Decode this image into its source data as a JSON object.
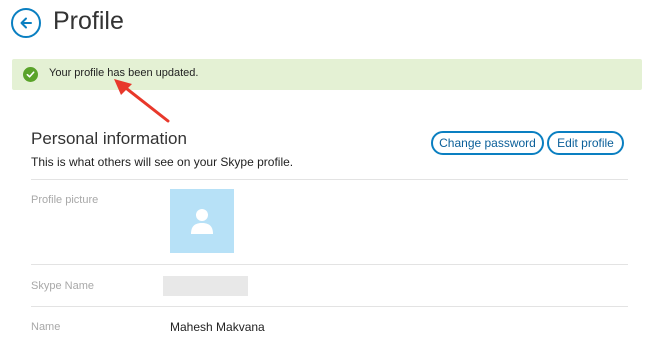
{
  "header": {
    "back_icon": "back-arrow-icon",
    "title": "Profile"
  },
  "banner": {
    "icon": "check-circle-icon",
    "message": "Your profile has been updated."
  },
  "personal_info": {
    "title": "Personal information",
    "subtitle": "This is what others will see on your Skype profile.",
    "change_password_label": "Change password",
    "edit_profile_label": "Edit profile"
  },
  "fields": {
    "profile_picture_label": "Profile picture",
    "skype_name_label": "Skype Name",
    "skype_name_value": "",
    "name_label": "Name",
    "name_value": "Mahesh Makvana"
  },
  "colors": {
    "accent": "#0a7fc1",
    "banner_bg": "#e4f1d4",
    "success": "#5aa32a",
    "annotation_arrow": "#e8382b"
  }
}
